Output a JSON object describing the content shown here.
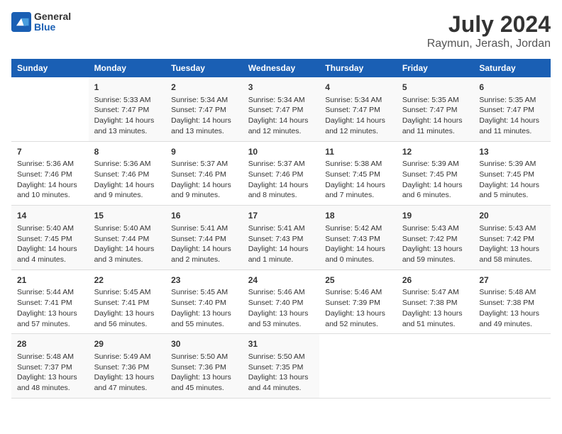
{
  "logo": {
    "general": "General",
    "blue": "Blue"
  },
  "title": "July 2024",
  "subtitle": "Raymun, Jerash, Jordan",
  "days_of_week": [
    "Sunday",
    "Monday",
    "Tuesday",
    "Wednesday",
    "Thursday",
    "Friday",
    "Saturday"
  ],
  "weeks": [
    [
      {
        "day": "",
        "content": ""
      },
      {
        "day": "1",
        "content": "Sunrise: 5:33 AM\nSunset: 7:47 PM\nDaylight: 14 hours\nand 13 minutes."
      },
      {
        "day": "2",
        "content": "Sunrise: 5:34 AM\nSunset: 7:47 PM\nDaylight: 14 hours\nand 13 minutes."
      },
      {
        "day": "3",
        "content": "Sunrise: 5:34 AM\nSunset: 7:47 PM\nDaylight: 14 hours\nand 12 minutes."
      },
      {
        "day": "4",
        "content": "Sunrise: 5:34 AM\nSunset: 7:47 PM\nDaylight: 14 hours\nand 12 minutes."
      },
      {
        "day": "5",
        "content": "Sunrise: 5:35 AM\nSunset: 7:47 PM\nDaylight: 14 hours\nand 11 minutes."
      },
      {
        "day": "6",
        "content": "Sunrise: 5:35 AM\nSunset: 7:47 PM\nDaylight: 14 hours\nand 11 minutes."
      }
    ],
    [
      {
        "day": "7",
        "content": "Sunrise: 5:36 AM\nSunset: 7:46 PM\nDaylight: 14 hours\nand 10 minutes."
      },
      {
        "day": "8",
        "content": "Sunrise: 5:36 AM\nSunset: 7:46 PM\nDaylight: 14 hours\nand 9 minutes."
      },
      {
        "day": "9",
        "content": "Sunrise: 5:37 AM\nSunset: 7:46 PM\nDaylight: 14 hours\nand 9 minutes."
      },
      {
        "day": "10",
        "content": "Sunrise: 5:37 AM\nSunset: 7:46 PM\nDaylight: 14 hours\nand 8 minutes."
      },
      {
        "day": "11",
        "content": "Sunrise: 5:38 AM\nSunset: 7:45 PM\nDaylight: 14 hours\nand 7 minutes."
      },
      {
        "day": "12",
        "content": "Sunrise: 5:39 AM\nSunset: 7:45 PM\nDaylight: 14 hours\nand 6 minutes."
      },
      {
        "day": "13",
        "content": "Sunrise: 5:39 AM\nSunset: 7:45 PM\nDaylight: 14 hours\nand 5 minutes."
      }
    ],
    [
      {
        "day": "14",
        "content": "Sunrise: 5:40 AM\nSunset: 7:45 PM\nDaylight: 14 hours\nand 4 minutes."
      },
      {
        "day": "15",
        "content": "Sunrise: 5:40 AM\nSunset: 7:44 PM\nDaylight: 14 hours\nand 3 minutes."
      },
      {
        "day": "16",
        "content": "Sunrise: 5:41 AM\nSunset: 7:44 PM\nDaylight: 14 hours\nand 2 minutes."
      },
      {
        "day": "17",
        "content": "Sunrise: 5:41 AM\nSunset: 7:43 PM\nDaylight: 14 hours\nand 1 minute."
      },
      {
        "day": "18",
        "content": "Sunrise: 5:42 AM\nSunset: 7:43 PM\nDaylight: 14 hours\nand 0 minutes."
      },
      {
        "day": "19",
        "content": "Sunrise: 5:43 AM\nSunset: 7:42 PM\nDaylight: 13 hours\nand 59 minutes."
      },
      {
        "day": "20",
        "content": "Sunrise: 5:43 AM\nSunset: 7:42 PM\nDaylight: 13 hours\nand 58 minutes."
      }
    ],
    [
      {
        "day": "21",
        "content": "Sunrise: 5:44 AM\nSunset: 7:41 PM\nDaylight: 13 hours\nand 57 minutes."
      },
      {
        "day": "22",
        "content": "Sunrise: 5:45 AM\nSunset: 7:41 PM\nDaylight: 13 hours\nand 56 minutes."
      },
      {
        "day": "23",
        "content": "Sunrise: 5:45 AM\nSunset: 7:40 PM\nDaylight: 13 hours\nand 55 minutes."
      },
      {
        "day": "24",
        "content": "Sunrise: 5:46 AM\nSunset: 7:40 PM\nDaylight: 13 hours\nand 53 minutes."
      },
      {
        "day": "25",
        "content": "Sunrise: 5:46 AM\nSunset: 7:39 PM\nDaylight: 13 hours\nand 52 minutes."
      },
      {
        "day": "26",
        "content": "Sunrise: 5:47 AM\nSunset: 7:38 PM\nDaylight: 13 hours\nand 51 minutes."
      },
      {
        "day": "27",
        "content": "Sunrise: 5:48 AM\nSunset: 7:38 PM\nDaylight: 13 hours\nand 49 minutes."
      }
    ],
    [
      {
        "day": "28",
        "content": "Sunrise: 5:48 AM\nSunset: 7:37 PM\nDaylight: 13 hours\nand 48 minutes."
      },
      {
        "day": "29",
        "content": "Sunrise: 5:49 AM\nSunset: 7:36 PM\nDaylight: 13 hours\nand 47 minutes."
      },
      {
        "day": "30",
        "content": "Sunrise: 5:50 AM\nSunset: 7:36 PM\nDaylight: 13 hours\nand 45 minutes."
      },
      {
        "day": "31",
        "content": "Sunrise: 5:50 AM\nSunset: 7:35 PM\nDaylight: 13 hours\nand 44 minutes."
      },
      {
        "day": "",
        "content": ""
      },
      {
        "day": "",
        "content": ""
      },
      {
        "day": "",
        "content": ""
      }
    ]
  ]
}
